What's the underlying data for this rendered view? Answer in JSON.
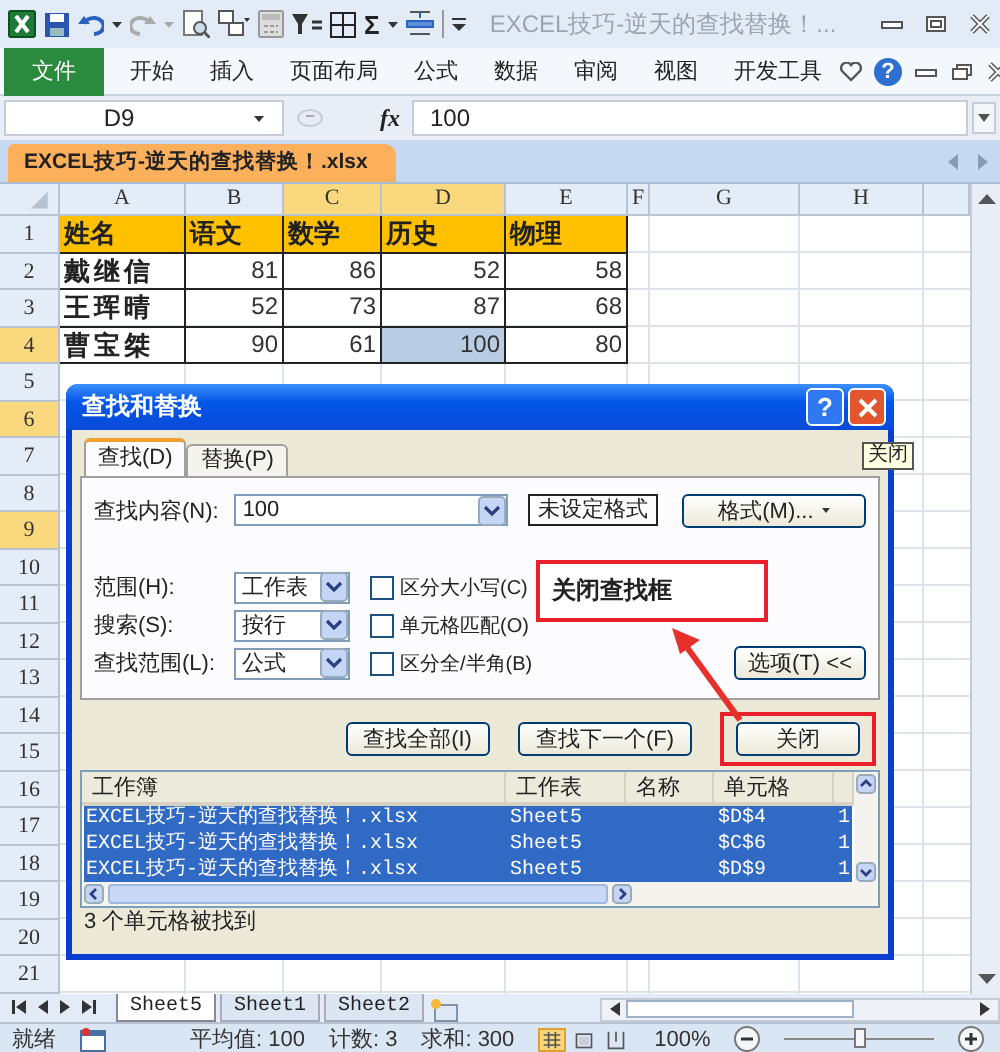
{
  "title_bar": {
    "title": "EXCEL技巧-逆天的查找替换！...",
    "sum_symbol": "Σ"
  },
  "ribbon": {
    "tabs": [
      {
        "label": "文件",
        "kind": "file"
      },
      {
        "label": "开始",
        "kind": "tab"
      },
      {
        "label": "插入",
        "kind": "tab"
      },
      {
        "label": "页面布局",
        "kind": "tab"
      },
      {
        "label": "公式",
        "kind": "tab"
      },
      {
        "label": "数据",
        "kind": "tab"
      },
      {
        "label": "审阅",
        "kind": "tab"
      },
      {
        "label": "视图",
        "kind": "tab"
      },
      {
        "label": "开发工具",
        "kind": "tab"
      }
    ],
    "help": "?"
  },
  "formula_bar": {
    "name_box": "D9",
    "fx": "fx",
    "formula": "100"
  },
  "workbook_tab": {
    "title": "EXCEL技巧-逆天的查找替换！.xlsx"
  },
  "sheet": {
    "columns": [
      {
        "label": "A",
        "selected": false
      },
      {
        "label": "B",
        "selected": false
      },
      {
        "label": "C",
        "selected": true
      },
      {
        "label": "D",
        "selected": true
      },
      {
        "label": "E",
        "selected": false
      },
      {
        "label": "F",
        "selected": false
      },
      {
        "label": "G",
        "selected": false
      },
      {
        "label": "H",
        "selected": false
      }
    ],
    "rows": [
      {
        "number": "1",
        "selected": false,
        "kind": "header",
        "cells": [
          {
            "text": "姓名",
            "selected": false
          },
          {
            "text": "语文",
            "selected": false
          },
          {
            "text": "数学",
            "selected": false
          },
          {
            "text": "历史",
            "selected": false
          },
          {
            "text": "物理",
            "selected": false
          }
        ]
      },
      {
        "number": "2",
        "selected": false,
        "kind": "data",
        "cells": [
          {
            "text": "戴继信",
            "selected": false
          },
          {
            "text": "81",
            "selected": false
          },
          {
            "text": "86",
            "selected": false
          },
          {
            "text": "52",
            "selected": false
          },
          {
            "text": "58",
            "selected": false
          }
        ]
      },
      {
        "number": "3",
        "selected": false,
        "kind": "data",
        "cells": [
          {
            "text": "王珲晴",
            "selected": false
          },
          {
            "text": "52",
            "selected": false
          },
          {
            "text": "73",
            "selected": false
          },
          {
            "text": "87",
            "selected": false
          },
          {
            "text": "68",
            "selected": false
          }
        ]
      },
      {
        "number": "4",
        "selected": true,
        "kind": "data",
        "cells": [
          {
            "text": "曹宝桀",
            "selected": false
          },
          {
            "text": "90",
            "selected": false
          },
          {
            "text": "61",
            "selected": false
          },
          {
            "text": "100",
            "selected": true
          },
          {
            "text": "80",
            "selected": false
          }
        ]
      },
      {
        "number": "5",
        "selected": false
      },
      {
        "number": "6",
        "selected": true
      },
      {
        "number": "7",
        "selected": false
      },
      {
        "number": "8",
        "selected": false
      },
      {
        "number": "9",
        "selected": true
      },
      {
        "number": "10",
        "selected": false
      },
      {
        "number": "11",
        "selected": false
      },
      {
        "number": "12",
        "selected": false
      },
      {
        "number": "13",
        "selected": false
      },
      {
        "number": "14",
        "selected": false
      },
      {
        "number": "15",
        "selected": false
      },
      {
        "number": "16",
        "selected": false
      },
      {
        "number": "17",
        "selected": false
      },
      {
        "number": "18",
        "selected": false
      },
      {
        "number": "19",
        "selected": false
      },
      {
        "number": "20",
        "selected": false
      },
      {
        "number": "21",
        "selected": false
      }
    ]
  },
  "dialog": {
    "title": "查找和替换",
    "help": "?",
    "tabs": [
      {
        "label": "查找(D)",
        "selected": true
      },
      {
        "label": "替换(P)",
        "selected": false
      }
    ],
    "find_label": "查找内容(N):",
    "find_value": "100",
    "format_status": "未设定格式",
    "format_button": "格式(M)...",
    "options": [
      {
        "label": "范围(H):",
        "value": "工作表"
      },
      {
        "label": "搜索(S):",
        "value": "按行"
      },
      {
        "label": "查找范围(L):",
        "value": "公式"
      }
    ],
    "checkboxes": [
      {
        "label": "区分大小写(C)",
        "checked": false
      },
      {
        "label": "单元格匹配(O)",
        "checked": false
      },
      {
        "label": "区分全/半角(B)",
        "checked": false
      }
    ],
    "options_button": "选项(T) <<",
    "buttons": [
      {
        "label": "查找全部(I)",
        "highlighted": false
      },
      {
        "label": "查找下一个(F)",
        "highlighted": false
      },
      {
        "label": "关闭",
        "highlighted": true
      }
    ],
    "results": {
      "columns": [
        "工作簿",
        "工作表",
        "名称",
        "单元格"
      ],
      "rows": [
        {
          "selected": true,
          "cells": [
            "EXCEL技巧-逆天的查找替换！.xlsx",
            "Sheet5",
            "",
            "$D$4",
            "1"
          ]
        },
        {
          "selected": true,
          "cells": [
            "EXCEL技巧-逆天的查找替换！.xlsx",
            "Sheet5",
            "",
            "$C$6",
            "1"
          ]
        },
        {
          "selected": true,
          "cells": [
            "EXCEL技巧-逆天的查找替换！.xlsx",
            "Sheet5",
            "",
            "$D$9",
            "1"
          ]
        }
      ]
    },
    "status": "3 个单元格被找到"
  },
  "tooltip": {
    "text": "关闭"
  },
  "annotation": {
    "text": "关闭查找框"
  },
  "sheet_tabs": [
    {
      "label": "Sheet5",
      "selected": true
    },
    {
      "label": "Sheet1",
      "selected": false
    },
    {
      "label": "Sheet2",
      "selected": false
    }
  ],
  "status_bar": {
    "status": "就绪",
    "average": "平均值: 100",
    "count": "计数: 3",
    "sum": "求和: 300",
    "views": [
      {
        "kind": "normal",
        "selected": true
      },
      {
        "kind": "layout",
        "selected": false
      },
      {
        "kind": "break",
        "selected": false
      }
    ],
    "zoom": "100%",
    "zoom_slider": {
      "level": 0.5
    }
  }
}
